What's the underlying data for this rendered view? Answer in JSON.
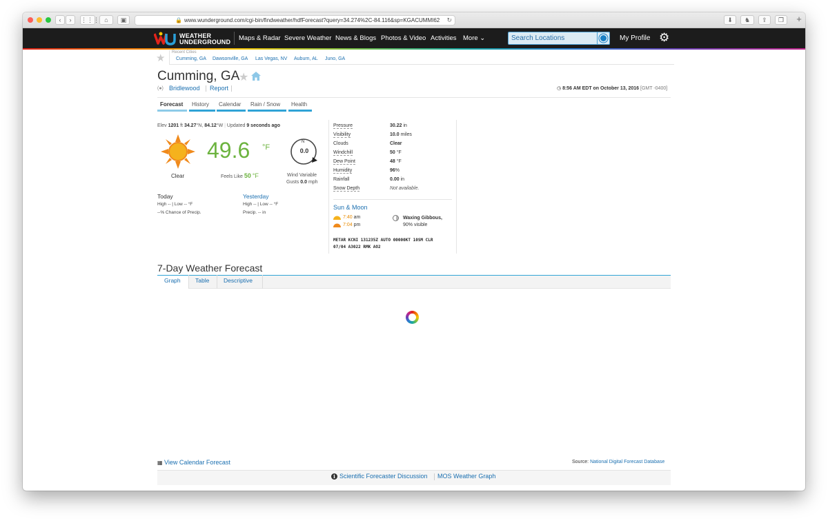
{
  "browser": {
    "url": "www.wunderground.com/cgi-bin/findweather/hdfForecast?query=34.274%2C-84.116&sp=KGACUMMI62",
    "reload_glyph": "↻"
  },
  "nav": {
    "logo_line1": "WEATHER",
    "logo_line2": "UNDERGROUND",
    "links": [
      "Maps & Radar",
      "Severe Weather",
      "News & Blogs",
      "Photos & Video",
      "Activities",
      "More"
    ],
    "search_placeholder": "Search Locations",
    "profile": "My Profile"
  },
  "recent": {
    "label": "Recent Cities",
    "cities": [
      "Cumming, GA",
      "Dawsonville, GA",
      "Las Vegas, NV",
      "Auburn, AL",
      "Juno, GA"
    ]
  },
  "location": {
    "title": "Cumming, GA",
    "station": "Bridlewood",
    "report": "Report",
    "time": "8:56 AM EDT on October 13, 2016",
    "gmt": "[GMT -0400]"
  },
  "tabs": [
    "Forecast",
    "History",
    "Calendar",
    "Rain / Snow",
    "Health"
  ],
  "current": {
    "elev_prefix": "Elev",
    "elev": "1201",
    "elev_unit": "ft",
    "lat": "34.27",
    "lat_unit": "°N,",
    "lon": "84.12",
    "lon_unit": "°W",
    "updated_prefix": "Updated",
    "updated": "9 seconds ago",
    "condition": "Clear",
    "temp": "49.6",
    "temp_unit": "°F",
    "feels_prefix": "Feels Like",
    "feels": "50",
    "feels_unit": "°F",
    "compass_n": "N",
    "wind_speed": "0.0",
    "wind_label": "Wind Variable",
    "gusts_prefix": "Gusts",
    "gusts": "0.0",
    "gusts_unit": "mph"
  },
  "today": {
    "title": "Today",
    "high_low": "High --  |  Low -- °F",
    "precip": "--% Chance of Precip."
  },
  "yesterday": {
    "title": "Yesterday",
    "high_low": "High --  |  Low -- °F",
    "precip": "Precip. -- in"
  },
  "details": [
    {
      "label": "Pressure",
      "value": "30.22",
      "unit": "in"
    },
    {
      "label": "Visibility",
      "value": "10.0",
      "unit": "miles"
    },
    {
      "label": "Clouds",
      "value": "Clear",
      "unit": ""
    },
    {
      "label": "Windchill",
      "value": "50",
      "unit": "°F"
    },
    {
      "label": "Dew Point",
      "value": "48",
      "unit": "°F"
    },
    {
      "label": "Humidity",
      "value": "96",
      "unit": "%"
    },
    {
      "label": "Rainfall",
      "value": "0.00",
      "unit": "in"
    },
    {
      "label": "Snow Depth",
      "value": "Not available.",
      "unit": ""
    }
  ],
  "sunmoon": {
    "title": "Sun & Moon",
    "sunrise": "7:40",
    "sunrise_unit": "am",
    "sunset": "7:04",
    "sunset_unit": "pm",
    "moon_phase": "Waxing Gibbous,",
    "moon_visible": "90% visible"
  },
  "metar": {
    "line1": "METAR KCNI 131235Z AUTO 00000KT 10SM CLR",
    "line2": "07/04 A3022 RMK AO2"
  },
  "forecast": {
    "title": "7-Day Weather Forecast",
    "tabs": [
      "Graph",
      "Table",
      "Descriptive"
    ]
  },
  "footer": {
    "calendar": "View Calendar Forecast",
    "source_prefix": "Source:",
    "source": "National Digital Forecast Database",
    "discussion": "Scientific Forecaster Discussion",
    "mos": "MOS Weather Graph"
  },
  "colors": {
    "accent": "#2fa3d6",
    "link": "#1a6fb0",
    "temp": "#6cb33f",
    "nav_bg": "#1c1c1c"
  }
}
